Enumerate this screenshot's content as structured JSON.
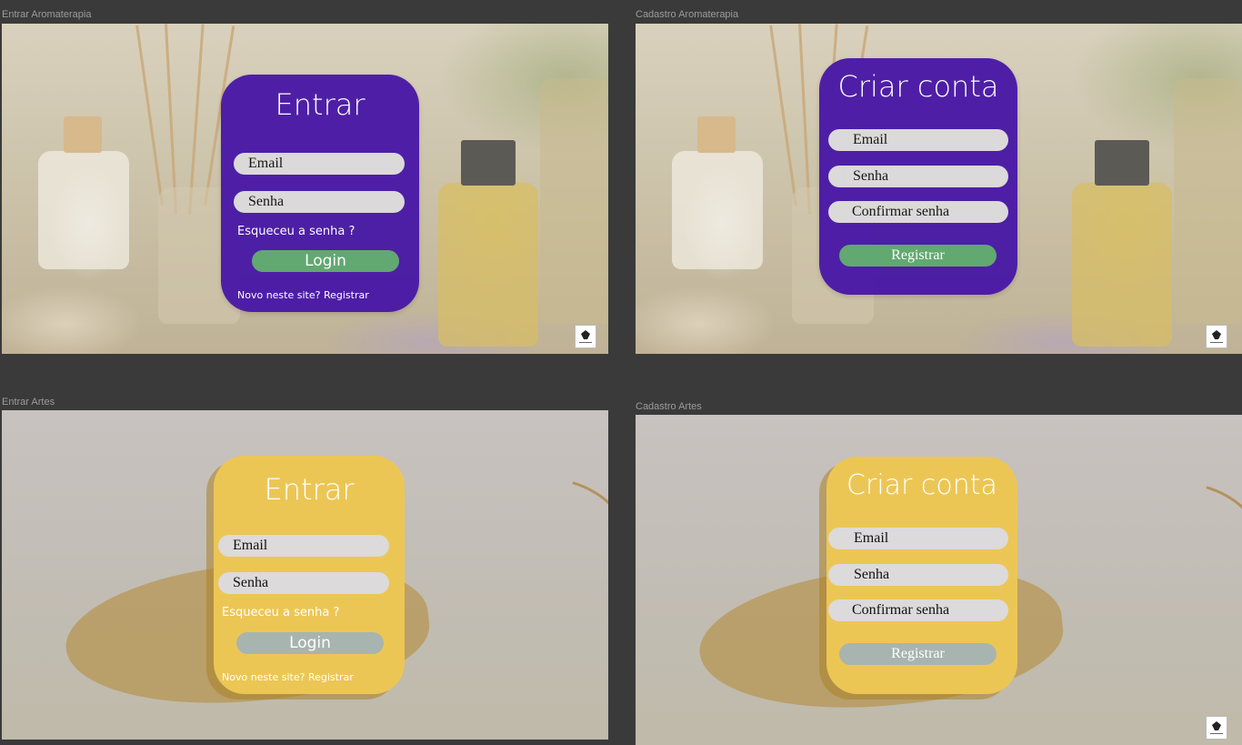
{
  "frames": {
    "entrar_aroma": {
      "label": "Entrar Aromaterapia",
      "title": "Entrar",
      "email": "Email",
      "senha": "Senha",
      "forgot": "Esqueceu a senha ?",
      "button": "Login",
      "footer": "Novo neste site? Registrar"
    },
    "cadastro_aroma": {
      "label": "Cadastro Aromaterapia",
      "title": "Criar conta",
      "email": "Email",
      "senha": "Senha",
      "confirm": "Confirmar senha",
      "button": "Registrar"
    },
    "entrar_artes": {
      "label": "Entrar Artes",
      "title": "Entrar",
      "email": "Email",
      "senha": "Senha",
      "forgot": "Esqueceu a senha ?",
      "button": "Login",
      "footer": "Novo neste site? Registrar"
    },
    "cadastro_artes": {
      "label": "Cadastro Artes",
      "title": "Criar conta",
      "email": "Email",
      "senha": "Senha",
      "confirm": "Confirmar senha",
      "button": "Registrar"
    }
  },
  "colors": {
    "canvas": "#3a3a3a",
    "purple_card": "#4a1aa6",
    "yellow_card": "#ecc655",
    "green_button": "#5fa870",
    "grey_button": "#a8b4af",
    "field": "#dcdadb"
  },
  "icons": [
    "brand-logo-icon"
  ]
}
